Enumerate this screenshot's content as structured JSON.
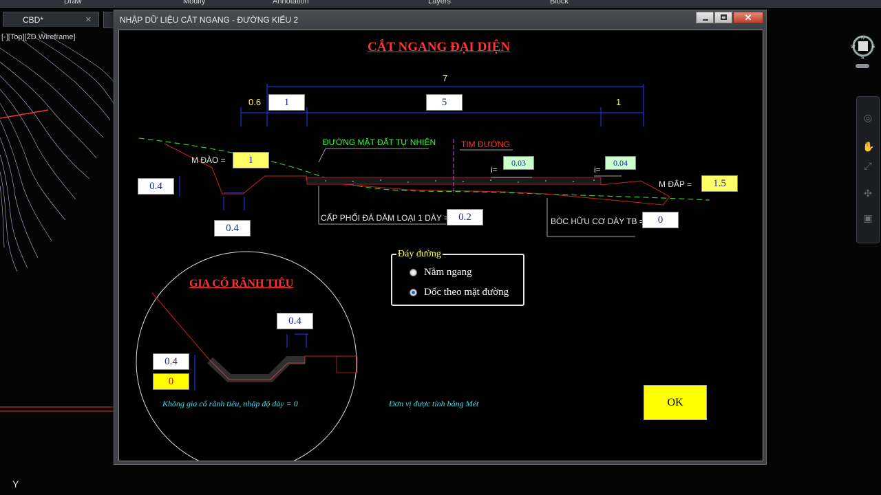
{
  "ribbon": [
    "Draw",
    "Modify",
    "Annotation",
    "Layers",
    "Block"
  ],
  "doc_tab": "CBD*",
  "view_label": "[-][Top][2D Wireframe]",
  "dialog": {
    "title": "NHẬP DỮ LIỆU CẮT NGANG - ĐƯỜNG KIỂU 2",
    "main_title": "CẮT NGANG ĐẠI DIỆN",
    "dims": {
      "total": "7",
      "left_outer": "0.6",
      "left": "1",
      "middle": "5",
      "right": "1"
    },
    "labels": {
      "natural_ground": "ĐƯỜNG MẶT ĐẤT TỰ NHIÊN",
      "centerline": "TIM ĐƯỜNG",
      "m_dao": "M ĐÀO  =",
      "m_dap": "M ĐẮP  =",
      "base_layer": "CẤP PHỐI ĐÁ DĂM LOẠI 1 DÀY  =",
      "topsoil": "BÓC HỮU CƠ DÀY TB  =",
      "i_left": "i=",
      "i_right": "i="
    },
    "values": {
      "m_dao": "1",
      "m_dap": "1.5",
      "slope_left": "0.03",
      "slope_right": "0.04",
      "ditch_depth": "0.4",
      "ditch_bottom": "0.4",
      "base_thickness": "0.2",
      "topsoil_thickness": "0"
    },
    "ditch": {
      "title": "GIA CỐ RÃNH TIÊU",
      "top_width": "0.4",
      "depth": "0.4",
      "lining_thickness": "0",
      "note": "Không gia cố rãnh tiêu, nhập độ dày = 0"
    },
    "road_bottom": {
      "legend": "Đáy đường",
      "options": [
        "Nằm ngang",
        "Dốc theo mặt đường"
      ],
      "selected_index": 1
    },
    "unit_note": "Đơn vị được tính bằng Mét",
    "ok_label": "OK"
  }
}
